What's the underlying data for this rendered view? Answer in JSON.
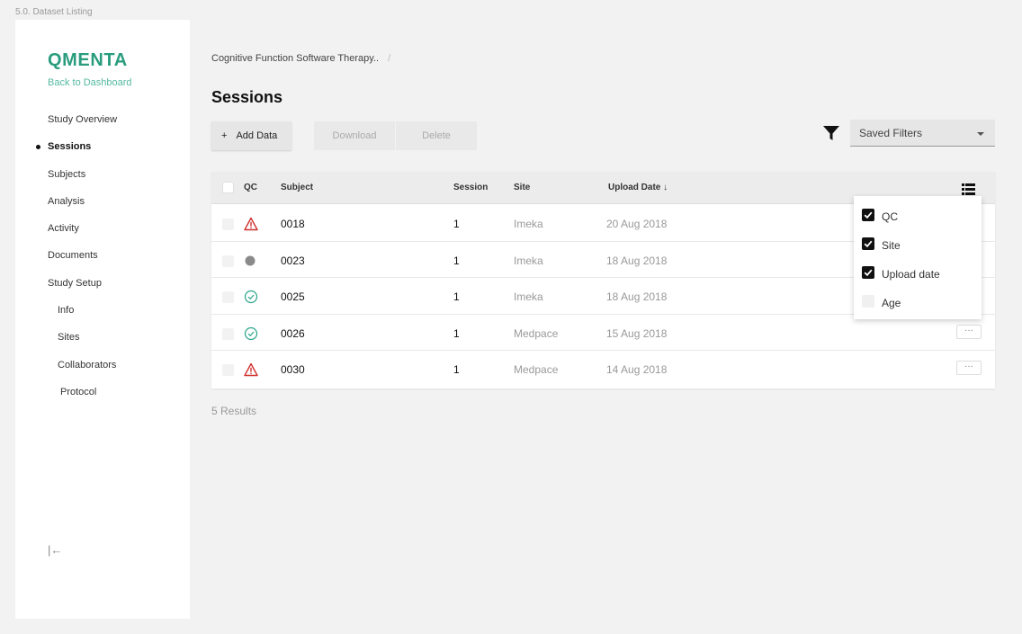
{
  "frame_label": "5.0. Dataset Listing",
  "sidebar": {
    "logo": "QMENTA",
    "back_link": "Back to Dashboard",
    "items": [
      {
        "label": "Study Overview"
      },
      {
        "label": "Sessions"
      },
      {
        "label": "Subjects"
      },
      {
        "label": "Analysis"
      },
      {
        "label": "Activity"
      },
      {
        "label": "Documents"
      },
      {
        "label": "Study Setup"
      },
      {
        "label": "Info"
      },
      {
        "label": "Sites"
      },
      {
        "label": "Collaborators"
      },
      {
        "label": "Protocol"
      }
    ],
    "active_item": "Sessions",
    "collapse_icon": "|←"
  },
  "breadcrumb": {
    "study": "Cognitive Function Software Therapy..",
    "separator": "/"
  },
  "page_title": "Sessions",
  "toolbar": {
    "add_plus": "+",
    "add_label": "Add Data",
    "download_label": "Download",
    "delete_label": "Delete",
    "filter_icon": "funnel-icon",
    "saved_filters": "Saved Filters"
  },
  "table": {
    "headers": {
      "qc": "QC",
      "subject": "Subject",
      "session": "Session",
      "site": "Site",
      "upload_date": "Upload Date ↓"
    },
    "rows": [
      {
        "qc": "warning",
        "subject": "0018",
        "session": "1",
        "site": "Imeka",
        "date": "20 Aug 2018",
        "menu": "···"
      },
      {
        "qc": "pending",
        "subject": "0023",
        "session": "1",
        "site": "Imeka",
        "date": "18 Aug 2018",
        "menu": "···"
      },
      {
        "qc": "passed",
        "subject": "0025",
        "session": "1",
        "site": "Imeka",
        "date": "18 Aug 2018",
        "menu": "···"
      },
      {
        "qc": "passed",
        "subject": "0026",
        "session": "1",
        "site": "Medpace",
        "date": "15 Aug 2018",
        "menu": "···"
      },
      {
        "qc": "warning",
        "subject": "0030",
        "session": "1",
        "site": "Medpace",
        "date": "14 Aug 2018",
        "menu": "···"
      }
    ]
  },
  "results": "5 Results",
  "column_picker": {
    "items": [
      {
        "label": "QC",
        "checked": true
      },
      {
        "label": "Site",
        "checked": true
      },
      {
        "label": "Upload date",
        "checked": true
      },
      {
        "label": "Age",
        "checked": false
      }
    ]
  },
  "colors": {
    "brand": "#2a9d7f",
    "warning": "#d0312d",
    "passed": "#2aa58a",
    "pending": "#8a8a8a"
  }
}
